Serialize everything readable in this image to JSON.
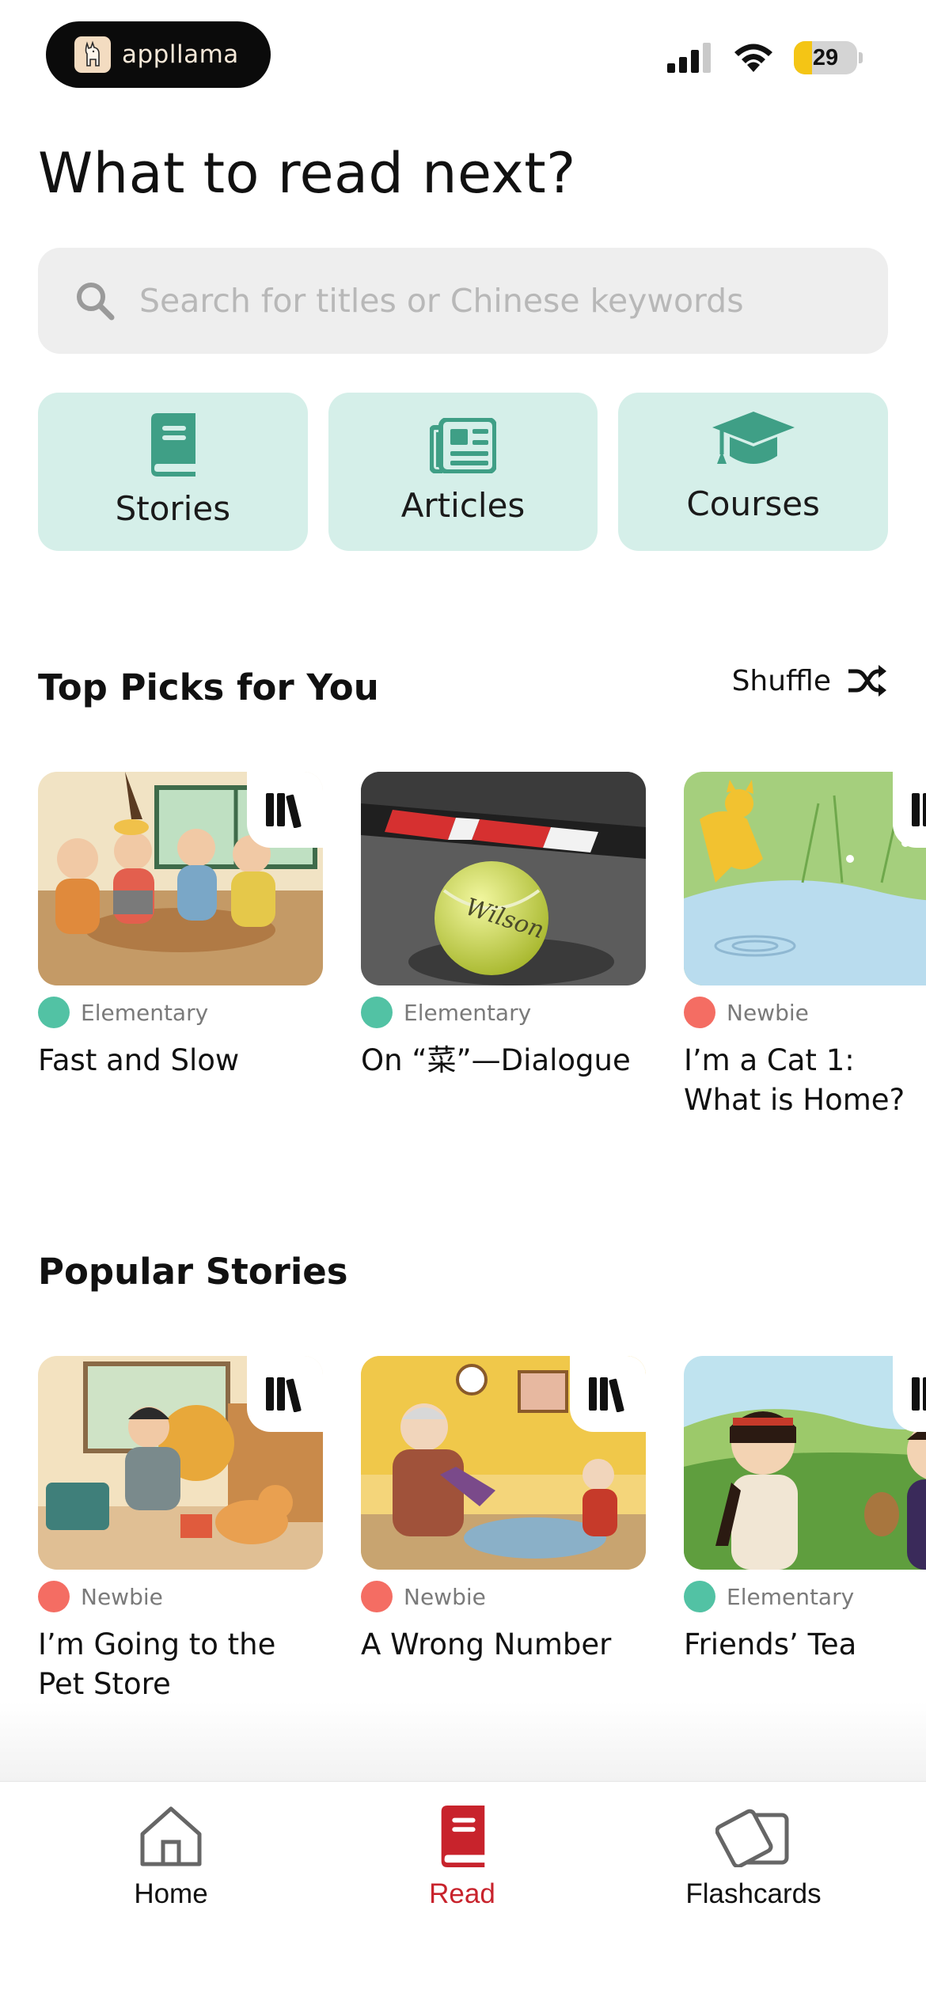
{
  "status_bar": {
    "app_name": "appllama",
    "battery_percent": "29",
    "battery_level": 0.29,
    "icons": [
      "signal-icon",
      "wifi-icon",
      "battery-icon"
    ]
  },
  "page_title": "What to read next?",
  "search": {
    "placeholder": "Search for titles or Chinese keywords",
    "value": ""
  },
  "categories": [
    {
      "label": "Stories",
      "icon": "book-icon"
    },
    {
      "label": "Articles",
      "icon": "newspaper-icon"
    },
    {
      "label": "Courses",
      "icon": "graduation-cap-icon"
    }
  ],
  "top_picks": {
    "title": "Top Picks for You",
    "shuffle_label": "Shuffle",
    "items": [
      {
        "level": "Elementary",
        "title": "Fast and Slow",
        "level_color": "#52c2a4"
      },
      {
        "level": "Elementary",
        "title": "On “菜”—Dialogue",
        "level_color": "#52c2a4"
      },
      {
        "level": "Newbie",
        "title": "I’m a Cat 1: What is Home?",
        "level_color": "#f46d63"
      }
    ]
  },
  "popular_stories": {
    "title": "Popular Stories",
    "items": [
      {
        "level": "Newbie",
        "title": "I’m Going to the Pet Store",
        "level_color": "#f46d63"
      },
      {
        "level": "Newbie",
        "title": "A Wrong Number",
        "level_color": "#f46d63"
      },
      {
        "level": "Elementary",
        "title": "Friends’ Tea",
        "level_color": "#52c2a4"
      }
    ]
  },
  "tabbar": {
    "tabs": [
      {
        "label": "Home",
        "icon": "home-icon",
        "active": false
      },
      {
        "label": "Read",
        "icon": "book-icon",
        "active": true
      },
      {
        "label": "Flashcards",
        "icon": "cards-icon",
        "active": false
      }
    ]
  },
  "colors": {
    "accent_teal": "#3f9f86",
    "category_bg": "#d5efe9",
    "active_tab": "#c8232c",
    "newbie": "#f46d63",
    "elementary": "#52c2a4"
  }
}
